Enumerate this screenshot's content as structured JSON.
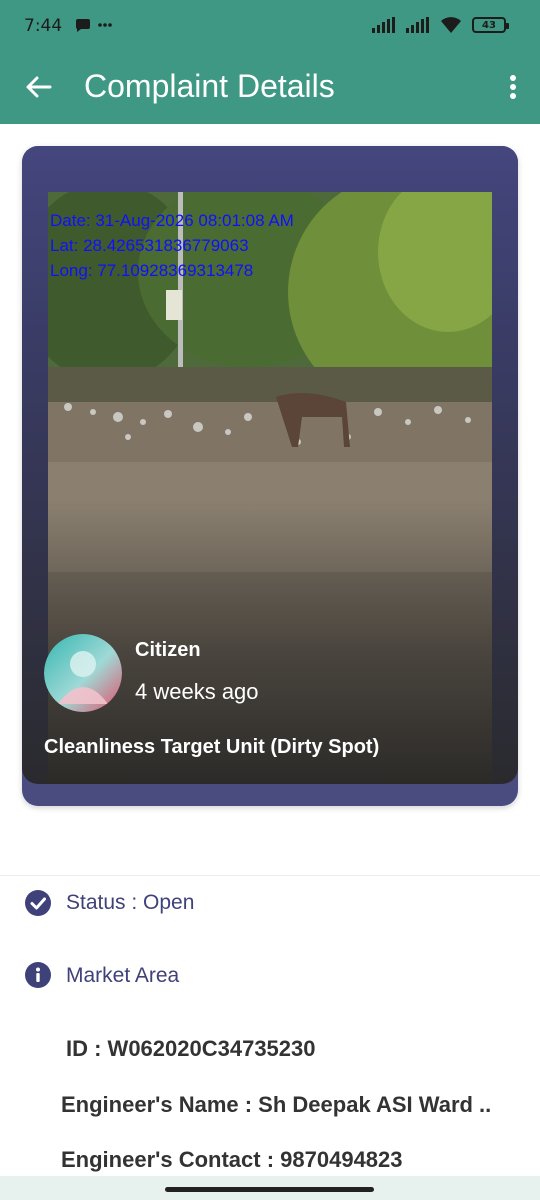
{
  "status_bar": {
    "time": "7:44",
    "left_icons": "● ···",
    "battery": "43"
  },
  "app_bar": {
    "title": "Complaint Details",
    "back_icon": "arrow-left-icon",
    "menu_icon": "more-vert-icon"
  },
  "complaint_card": {
    "photo_stamp": {
      "date": "Date: 31-Aug-2026 08:01:08 AM",
      "lat": "Lat: 28.4265318367790​63",
      "long": "Long: 77.10928369313478"
    },
    "reporter_role": "Citizen",
    "reported_ago": "4 weeks ago",
    "category": "Cleanliness Target Unit (Dirty Spot)"
  },
  "info_rows": {
    "status": "Status : Open",
    "area": "Market Area"
  },
  "details": {
    "id": "ID :  W062020C34735230",
    "engineer_name": "Engineer's Name : Sh Deepak ASI Ward ..",
    "engineer_contact": "Engineer's Contact : 9870494823"
  },
  "colors": {
    "app_bar": "#3e9884",
    "card": "#4a4c80",
    "accent_text": "#3f4279",
    "stamp": "#1010ff"
  }
}
